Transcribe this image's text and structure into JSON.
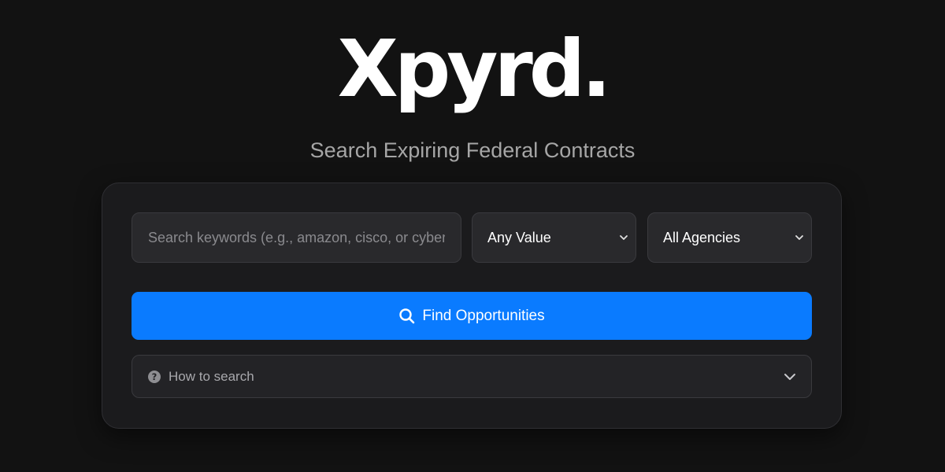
{
  "brand": {
    "logo_text": "Xpyrd."
  },
  "hero": {
    "subtitle": "Search Expiring Federal Contracts"
  },
  "search": {
    "placeholder": "Search keywords (e.g., amazon, cisco, or cybersecurity)",
    "value": ""
  },
  "filters": {
    "value_select": {
      "selected": "Any Value",
      "icon": "chevron-down-icon"
    },
    "agency_select": {
      "selected": "All Agencies",
      "icon": "chevron-down-icon"
    }
  },
  "find_button": {
    "label": "Find Opportunities",
    "icon": "search-icon"
  },
  "how_to": {
    "label": "How to search",
    "icon": "question-circle-icon",
    "expand_icon": "chevron-down-icon"
  },
  "colors": {
    "background": "#121212",
    "card": "#1b1b1d",
    "accent": "#0a7bff",
    "text_primary": "#ffffff",
    "text_muted": "#a6a6a6"
  }
}
